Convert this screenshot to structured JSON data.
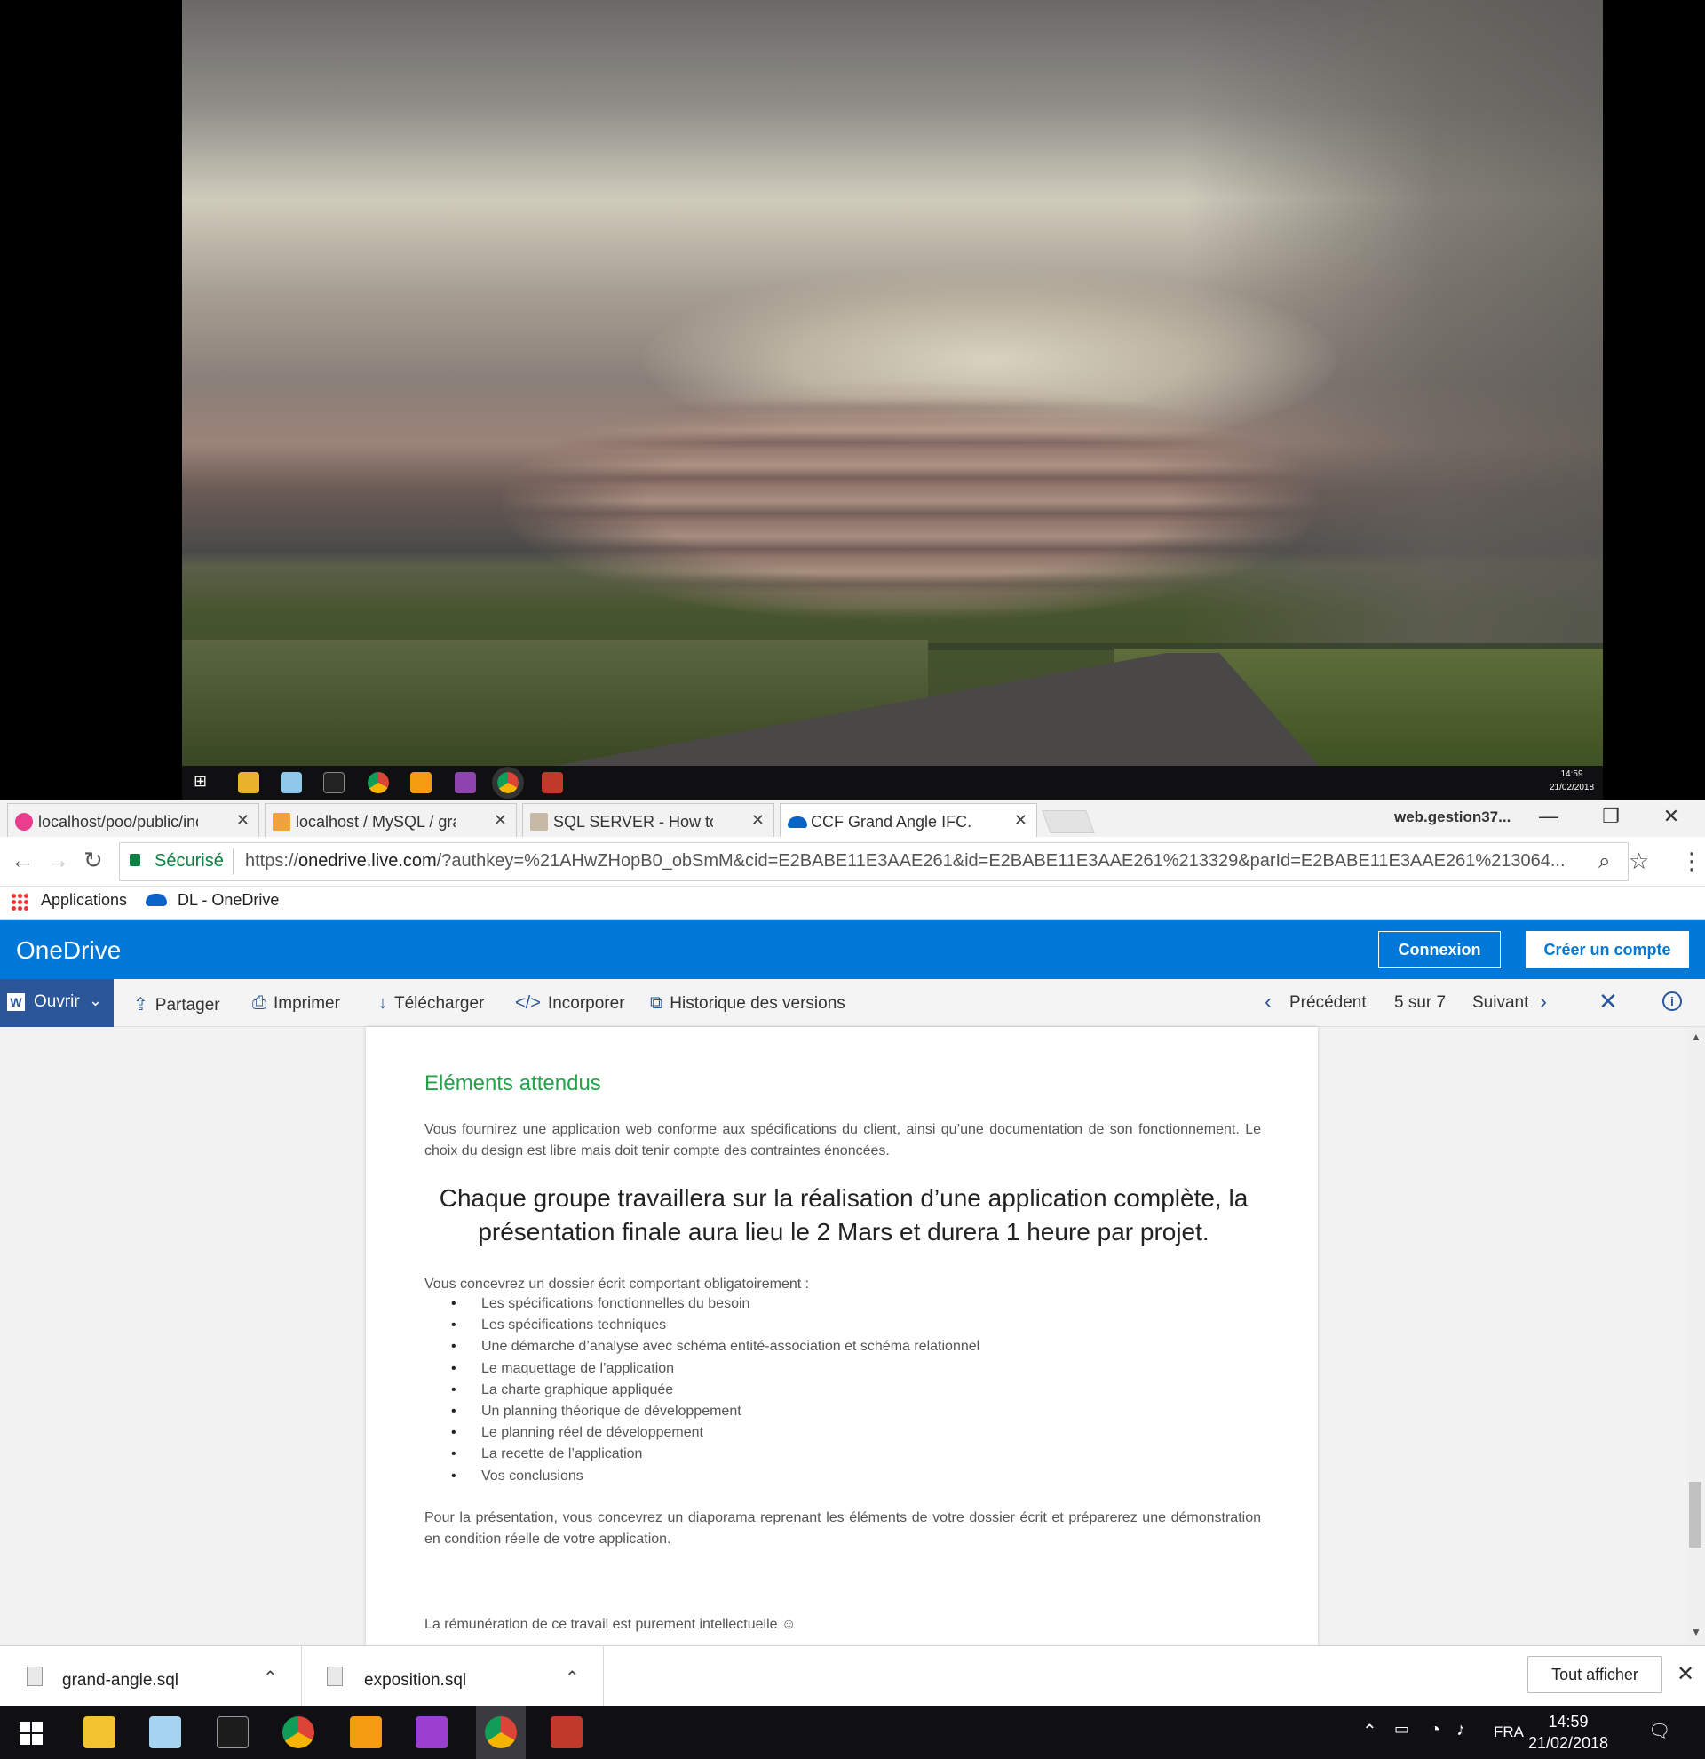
{
  "wallpaper": {
    "description_icon": "storm-wallpaper"
  },
  "mini_taskbar": {
    "time": "14:59",
    "date": "21/02/2018"
  },
  "browser": {
    "tabs": [
      {
        "title": "localhost/poo/public/ind",
        "favicon": "wamp-icon"
      },
      {
        "title": "localhost / MySQL / gran",
        "favicon": "phpmyadmin-icon"
      },
      {
        "title": "SQL SERVER - How to Up",
        "favicon": "blog-icon"
      },
      {
        "title": "CCF Grand Angle IFC.pdf",
        "favicon": "onedrive-icon",
        "active": true
      }
    ],
    "profile_name": "web.gestion37...",
    "secure_label": "Sécurisé",
    "url_prefix": "https://",
    "url_host": "onedrive.live.com",
    "url_rest": "/?authkey=%21AHwZHopB0_obSmM&cid=E2BABE11E3AAE261&id=E2BABE11E3AAE261%213329&parId=E2BABE11E3AAE261%213064...",
    "bookmarks": [
      {
        "label": "Applications",
        "icon": "apps-grid-icon"
      },
      {
        "label": "DL - OneDrive",
        "icon": "onedrive-icon"
      }
    ]
  },
  "onedrive": {
    "brand": "OneDrive",
    "connexion_label": "Connexion",
    "create_account_label": "Créer un compte",
    "commands": {
      "open": "Ouvrir",
      "share": "Partager",
      "print": "Imprimer",
      "download": "Télécharger",
      "embed": "Incorporer",
      "history": "Historique des versions",
      "previous": "Précédent",
      "page_position": "5 sur 7",
      "next": "Suivant"
    },
    "accent_color": "#0078d7"
  },
  "document": {
    "heading": "Eléments attendus",
    "intro": "Vous fournirez une application web conforme aux spécifications du client, ainsi qu’une documentation de son fonctionnement. Le choix du design est libre mais doit tenir compte des contraintes énoncées.",
    "highlight_line1": "Chaque groupe travaillera sur la réalisation d’une application complète, la",
    "highlight_line2": "présentation finale aura lieu le 2 Mars et durera 1 heure par projet.",
    "dossier_intro": "Vous concevrez un dossier écrit comportant obligatoirement :",
    "items": [
      "Les spécifications fonctionnelles du besoin",
      "Les spécifications techniques",
      "Une démarche d’analyse avec schéma entité-association et schéma relationnel",
      "Le maquettage de l’application",
      "La charte graphique appliquée",
      "Un planning théorique de développement",
      "Le planning réel de développement",
      "La recette de l’application",
      "Vos conclusions"
    ],
    "presentation": "Pour la présentation, vous concevrez un diaporama reprenant les éléments de votre dossier écrit et préparerez une démonstration en condition réelle de votre application.",
    "remuneration": "La rémunération de ce travail est purement intellectuelle ☺"
  },
  "downloads": {
    "items": [
      {
        "name": "grand-angle.sql"
      },
      {
        "name": "exposition.sql"
      }
    ],
    "show_all_label": "Tout afficher"
  },
  "taskbar": {
    "language": "FRA",
    "time": "14:59",
    "date": "21/02/2018"
  }
}
